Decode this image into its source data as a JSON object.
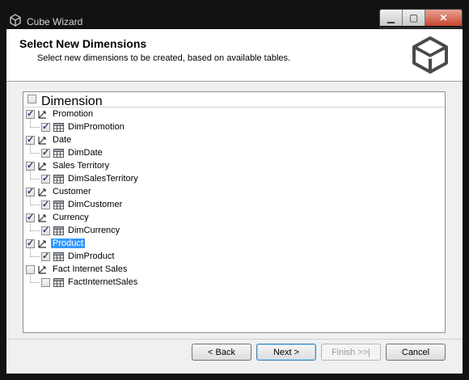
{
  "window": {
    "title": "Cube Wizard"
  },
  "header": {
    "title": "Select New Dimensions",
    "subtitle": "Select new dimensions to be created, based on available tables."
  },
  "tree": {
    "column_header": "Dimension",
    "items": [
      {
        "dimension": "Promotion",
        "dimension_checked": true,
        "table": "DimPromotion",
        "table_checked": true,
        "selected": false
      },
      {
        "dimension": "Date",
        "dimension_checked": true,
        "table": "DimDate",
        "table_checked": true,
        "selected": false
      },
      {
        "dimension": "Sales Territory",
        "dimension_checked": true,
        "table": "DimSalesTerritory",
        "table_checked": true,
        "selected": false
      },
      {
        "dimension": "Customer",
        "dimension_checked": true,
        "table": "DimCustomer",
        "table_checked": true,
        "selected": false
      },
      {
        "dimension": "Currency",
        "dimension_checked": true,
        "table": "DimCurrency",
        "table_checked": true,
        "selected": false
      },
      {
        "dimension": "Product",
        "dimension_checked": true,
        "table": "DimProduct",
        "table_checked": true,
        "selected": true
      },
      {
        "dimension": "Fact Internet Sales",
        "dimension_checked": false,
        "table": "FactInternetSales",
        "table_checked": false,
        "selected": false
      }
    ]
  },
  "buttons": {
    "back": "< Back",
    "next": "Next >",
    "finish": "Finish >>|",
    "cancel": "Cancel"
  },
  "icons": {
    "app": "cube-icon",
    "logo": "cube-wizard-logo",
    "dimension": "dimension-icon",
    "table": "table-icon"
  },
  "colors": {
    "selection": "#3399ff",
    "titlebar": "#121212",
    "close_button": "#c9452f"
  }
}
